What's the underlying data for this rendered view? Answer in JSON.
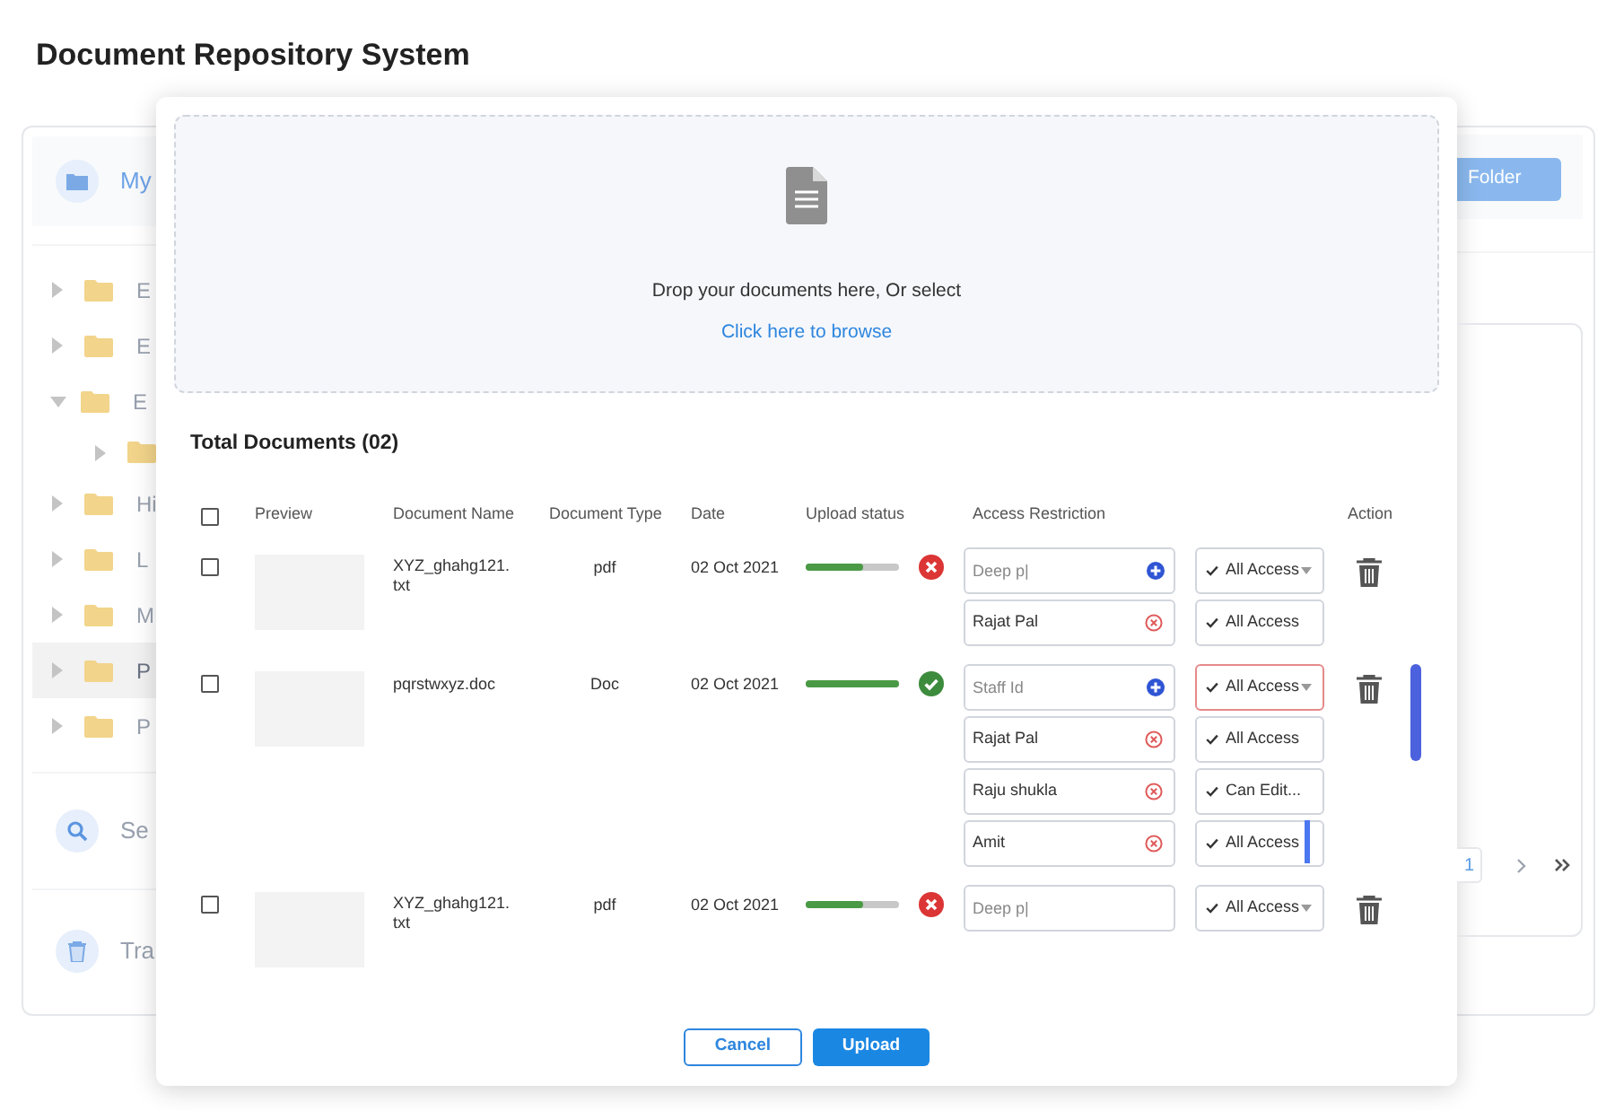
{
  "page_title": "Document Repository System",
  "sidebar": {
    "header": {
      "label": "My"
    },
    "items": [
      {
        "label": "E",
        "expanded": false,
        "selected": false
      },
      {
        "label": "E",
        "expanded": false,
        "selected": false
      },
      {
        "label": "E",
        "expanded": true,
        "selected": false,
        "children": [
          {
            "expanded": false,
            "selected": false
          }
        ]
      },
      {
        "label": "Hi",
        "expanded": false,
        "selected": false
      },
      {
        "label": "L",
        "expanded": false,
        "selected": false
      },
      {
        "label": "M",
        "expanded": false,
        "selected": false
      },
      {
        "label": "P",
        "expanded": false,
        "selected": true
      },
      {
        "label": "P",
        "expanded": false,
        "selected": false
      }
    ],
    "search": {
      "label": "Se"
    },
    "trash": {
      "label": "Tra"
    }
  },
  "toolbar": {
    "new_folder_button": "Folder"
  },
  "pagination": {
    "pages": [
      {
        "label": "1",
        "selected": true
      }
    ]
  },
  "upload_dialog": {
    "drop_zone": {
      "text": "Drop your documents here, Or select",
      "link": "Click here to browse"
    },
    "total": "Total Documents (02)",
    "all_checked": false,
    "columns": [
      "Preview",
      "Document Name",
      "Document Type",
      "Date",
      "Upload status",
      "Access Restriction",
      "Action"
    ],
    "rows": [
      {
        "checked": false,
        "name": "XYZ_ghahg121.txt",
        "type": "pdf",
        "date": "02 Oct 2021",
        "upload": {
          "level": 0.62,
          "failed": true
        },
        "access": [
          {
            "kind": "picker",
            "placeholder": "Deep p|",
            "permission": "All Access",
            "dropdown": true,
            "error": false
          },
          {
            "kind": "user",
            "user": "Rajat Pal",
            "permission": "All Access",
            "dropdown": false,
            "error": false
          }
        ]
      },
      {
        "checked": false,
        "name": "pqrstwxyz.doc",
        "type": "Doc",
        "date": "02 Oct 2021",
        "upload": {
          "level": 1,
          "failed": false
        },
        "access": [
          {
            "kind": "picker",
            "placeholder": "Staff Id",
            "permission": "All Access",
            "dropdown": true,
            "error": true
          },
          {
            "kind": "user",
            "user": "Rajat Pal",
            "permission": "All Access",
            "dropdown": false,
            "error": false
          },
          {
            "kind": "user",
            "user": "Raju shukla",
            "permission": "Can Edit...",
            "dropdown": false,
            "error": false
          },
          {
            "kind": "user",
            "user": "Amit",
            "permission": "All Access",
            "dropdown": false,
            "error": false
          }
        ]
      },
      {
        "checked": false,
        "name": "XYZ_ghahg121.txt",
        "type": "pdf",
        "date": "02 Oct 2021",
        "upload": {
          "level": 0.62,
          "failed": true
        },
        "access": [
          {
            "kind": "entry",
            "placeholder": "Deep p|",
            "permission": "All Access",
            "dropdown": true,
            "error": false
          }
        ]
      }
    ],
    "buttons": {
      "cancel": "Cancel",
      "upload": "Upload"
    }
  }
}
